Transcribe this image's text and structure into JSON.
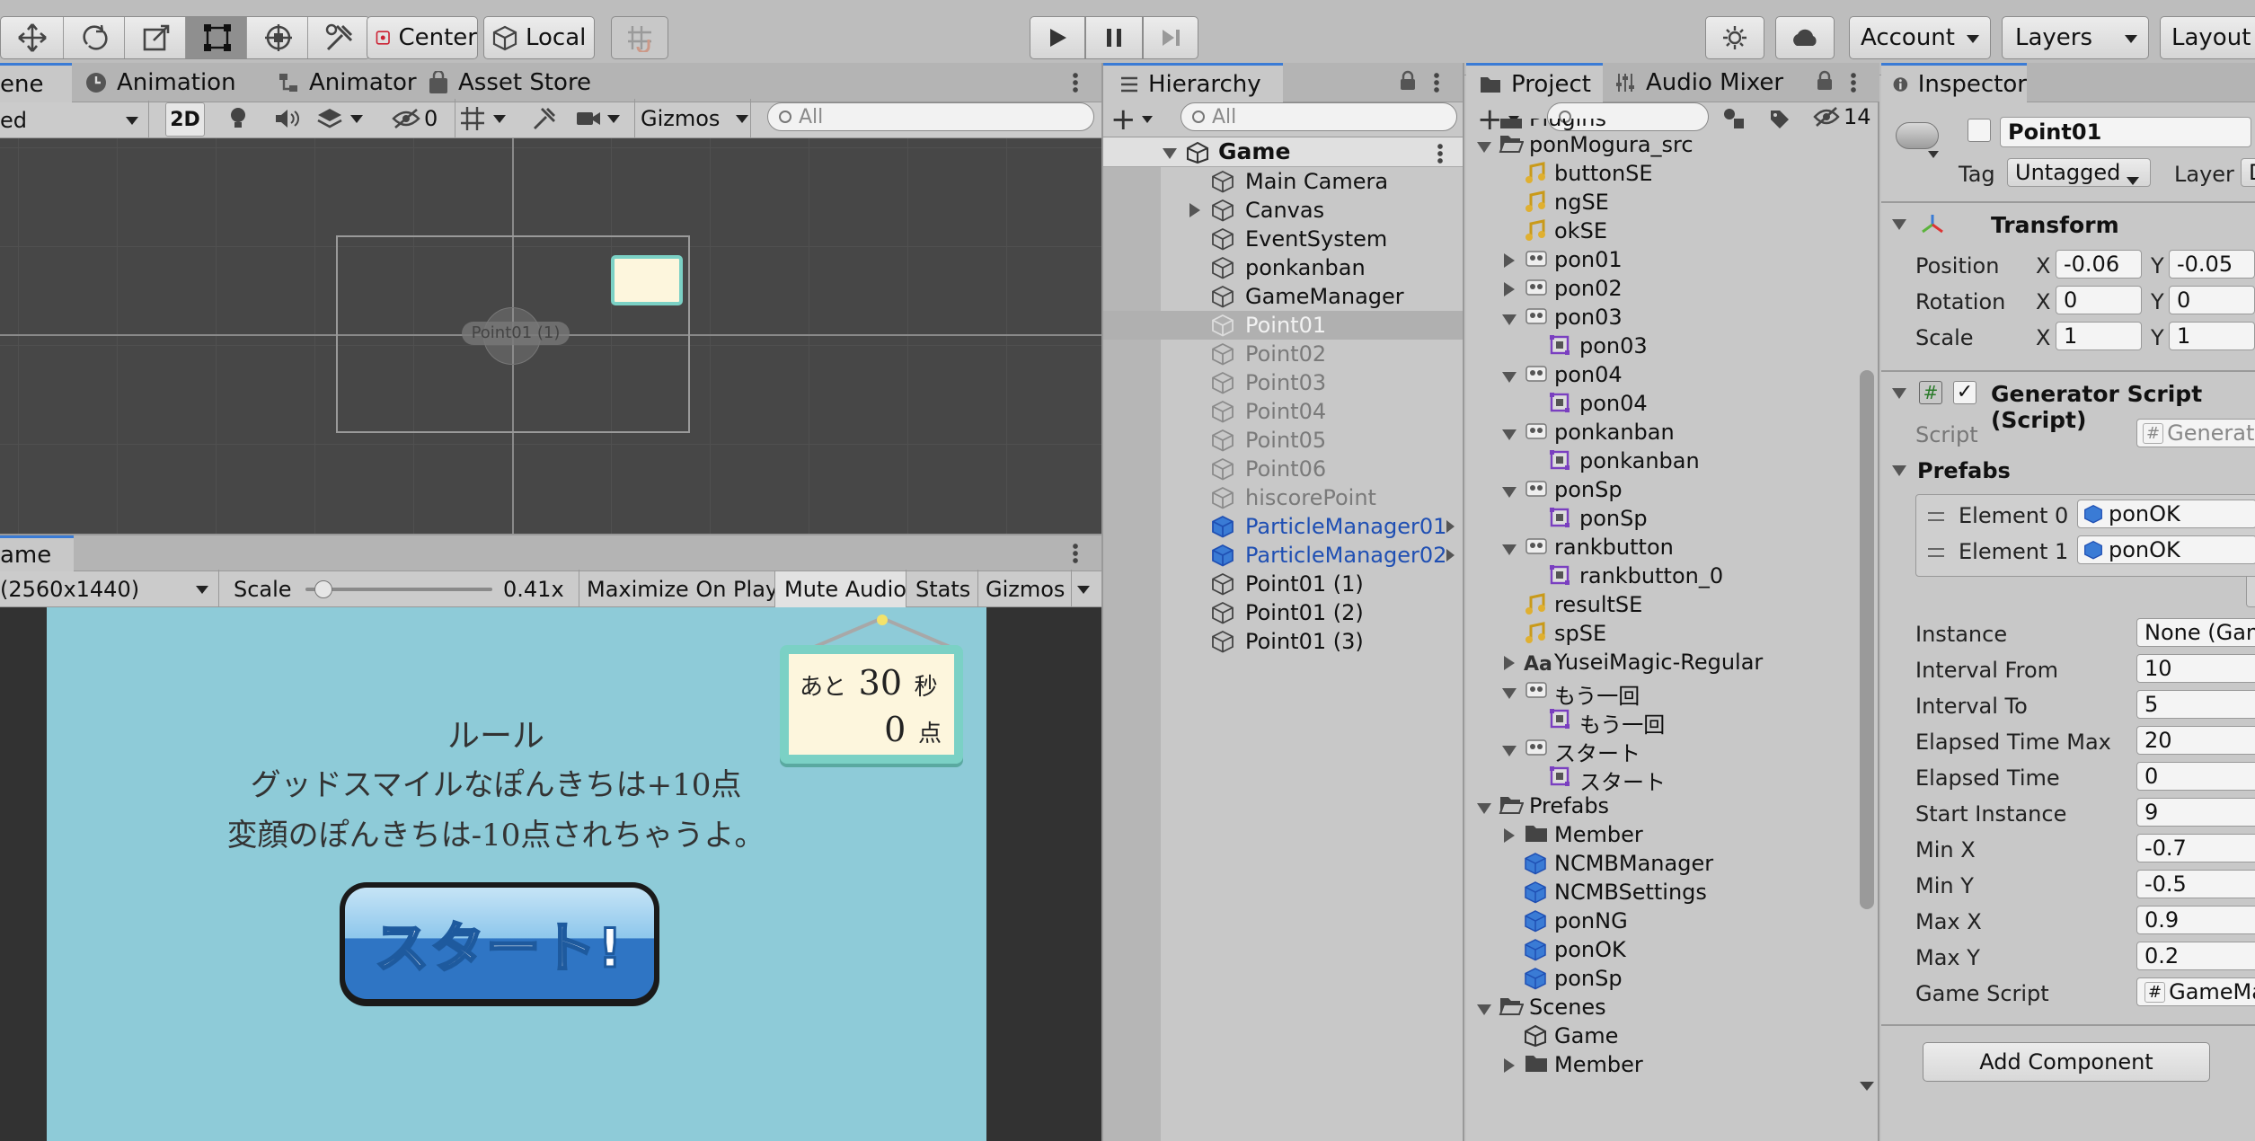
{
  "toolbar": {
    "center": "Center",
    "local": "Local",
    "account": "Account",
    "layers": "Layers",
    "layout": "Layout"
  },
  "scene": {
    "tabs": [
      "ene",
      "Animation",
      "Animator",
      "Asset Store"
    ],
    "shading": "ed",
    "mode2d": "2D",
    "hidden_count": "0",
    "gizmos": "Gizmos",
    "search_placeholder": "All",
    "object_label": "Point01 (1)"
  },
  "game": {
    "tab": "ame",
    "resolution": "(2560x1440)",
    "scale_label": "Scale",
    "scale_value": "0.41x",
    "scale_level": 0.05,
    "buttons": [
      "Maximize On Play",
      "Mute Audio",
      "Stats",
      "Gizmos"
    ],
    "rule_title": "ルール",
    "rule_line1": "グッドスマイルなぽんきちは+10点",
    "rule_line2": "変顔のぽんきちは-10点されちゃうよ。",
    "timer_prefix": "あと",
    "timer_value": "30",
    "timer_unit": "秒",
    "score_value": "0",
    "score_unit": "点",
    "start_button": "スタート!"
  },
  "hierarchy": {
    "tab": "Hierarchy",
    "search_placeholder": "All",
    "scene": "Game",
    "items": [
      {
        "label": "Main Camera",
        "state": "normal",
        "expandable": false
      },
      {
        "label": "Canvas",
        "state": "normal",
        "expandable": true
      },
      {
        "label": "EventSystem",
        "state": "normal",
        "expandable": false
      },
      {
        "label": "ponkanban",
        "state": "normal",
        "expandable": false
      },
      {
        "label": "GameManager",
        "state": "normal",
        "expandable": false
      },
      {
        "label": "Point01",
        "state": "selected",
        "expandable": false
      },
      {
        "label": "Point02",
        "state": "inactive",
        "expandable": false
      },
      {
        "label": "Point03",
        "state": "inactive",
        "expandable": false
      },
      {
        "label": "Point04",
        "state": "inactive",
        "expandable": false
      },
      {
        "label": "Point05",
        "state": "inactive",
        "expandable": false
      },
      {
        "label": "Point06",
        "state": "inactive",
        "expandable": false
      },
      {
        "label": "hiscorePoint",
        "state": "inactive",
        "expandable": false
      },
      {
        "label": "ParticleManager01",
        "state": "prefab",
        "expandable": false
      },
      {
        "label": "ParticleManager02",
        "state": "prefab",
        "expandable": false
      },
      {
        "label": "Point01 (1)",
        "state": "normal",
        "expandable": false
      },
      {
        "label": "Point01 (2)",
        "state": "normal",
        "expandable": false
      },
      {
        "label": "Point01 (3)",
        "state": "normal",
        "expandable": false
      }
    ]
  },
  "project": {
    "tabs": [
      "Project",
      "Audio Mixer"
    ],
    "hidden_count": "14",
    "items": [
      {
        "label": "Plugins",
        "indent": 0,
        "fold": "none",
        "icon": "folder"
      },
      {
        "label": "ponMogura_src",
        "indent": 0,
        "fold": "open",
        "icon": "folder-open"
      },
      {
        "label": "buttonSE",
        "indent": 1,
        "fold": "none",
        "icon": "audio"
      },
      {
        "label": "ngSE",
        "indent": 1,
        "fold": "none",
        "icon": "audio"
      },
      {
        "label": "okSE",
        "indent": 1,
        "fold": "none",
        "icon": "audio"
      },
      {
        "label": "pon01",
        "indent": 1,
        "fold": "closed",
        "icon": "texture"
      },
      {
        "label": "pon02",
        "indent": 1,
        "fold": "closed",
        "icon": "texture"
      },
      {
        "label": "pon03",
        "indent": 1,
        "fold": "open",
        "icon": "texture"
      },
      {
        "label": "pon03",
        "indent": 2,
        "fold": "none",
        "icon": "sprite"
      },
      {
        "label": "pon04",
        "indent": 1,
        "fold": "open",
        "icon": "texture"
      },
      {
        "label": "pon04",
        "indent": 2,
        "fold": "none",
        "icon": "sprite"
      },
      {
        "label": "ponkanban",
        "indent": 1,
        "fold": "open",
        "icon": "texture"
      },
      {
        "label": "ponkanban",
        "indent": 2,
        "fold": "none",
        "icon": "sprite"
      },
      {
        "label": "ponSp",
        "indent": 1,
        "fold": "open",
        "icon": "texture"
      },
      {
        "label": "ponSp",
        "indent": 2,
        "fold": "none",
        "icon": "sprite"
      },
      {
        "label": "rankbutton",
        "indent": 1,
        "fold": "open",
        "icon": "texture"
      },
      {
        "label": "rankbutton_0",
        "indent": 2,
        "fold": "none",
        "icon": "sprite"
      },
      {
        "label": "resultSE",
        "indent": 1,
        "fold": "none",
        "icon": "audio"
      },
      {
        "label": "spSE",
        "indent": 1,
        "fold": "none",
        "icon": "audio"
      },
      {
        "label": "YuseiMagic-Regular",
        "indent": 1,
        "fold": "closed",
        "icon": "font"
      },
      {
        "label": "もう一回",
        "indent": 1,
        "fold": "open",
        "icon": "texture"
      },
      {
        "label": "もう一回",
        "indent": 2,
        "fold": "none",
        "icon": "sprite"
      },
      {
        "label": "スタート",
        "indent": 1,
        "fold": "open",
        "icon": "texture"
      },
      {
        "label": "スタート",
        "indent": 2,
        "fold": "none",
        "icon": "sprite"
      },
      {
        "label": "Prefabs",
        "indent": 0,
        "fold": "open",
        "icon": "folder-open"
      },
      {
        "label": "Member",
        "indent": 1,
        "fold": "closed",
        "icon": "folder"
      },
      {
        "label": "NCMBManager",
        "indent": 1,
        "fold": "none",
        "icon": "prefab"
      },
      {
        "label": "NCMBSettings",
        "indent": 1,
        "fold": "none",
        "icon": "prefab"
      },
      {
        "label": "ponNG",
        "indent": 1,
        "fold": "none",
        "icon": "prefab"
      },
      {
        "label": "ponOK",
        "indent": 1,
        "fold": "none",
        "icon": "prefab"
      },
      {
        "label": "ponSp",
        "indent": 1,
        "fold": "none",
        "icon": "prefab"
      },
      {
        "label": "Scenes",
        "indent": 0,
        "fold": "open",
        "icon": "folder-open"
      },
      {
        "label": "Game",
        "indent": 1,
        "fold": "none",
        "icon": "unity"
      },
      {
        "label": "Member",
        "indent": 1,
        "fold": "closed",
        "icon": "folder"
      }
    ]
  },
  "inspector": {
    "tab": "Inspector",
    "name": "Point01",
    "tag_label": "Tag",
    "tag_value": "Untagged",
    "layer_label": "Layer",
    "layer_value": "D",
    "transform": {
      "title": "Transform",
      "rows": [
        {
          "label": "Position",
          "x": "-0.06",
          "y": "-0.05"
        },
        {
          "label": "Rotation",
          "x": "0",
          "y": "0"
        },
        {
          "label": "Scale",
          "x": "1",
          "y": "1"
        }
      ]
    },
    "script_component": {
      "title": "Generator Script (Script)",
      "script_label": "Script",
      "script_value": "Generator",
      "prefabs_label": "Prefabs",
      "elements": [
        {
          "label": "Element 0",
          "value": "ponOK"
        },
        {
          "label": "Element 1",
          "value": "ponOK"
        }
      ],
      "fields": [
        {
          "label": "Instance",
          "value": "None (Game"
        },
        {
          "label": "Interval From",
          "value": "10"
        },
        {
          "label": "Interval To",
          "value": "5"
        },
        {
          "label": "Elapsed Time Max",
          "value": "20"
        },
        {
          "label": "Elapsed Time",
          "value": "0"
        },
        {
          "label": "Start Instance",
          "value": "9"
        },
        {
          "label": "Min X",
          "value": "-0.7"
        },
        {
          "label": "Min Y",
          "value": "-0.5"
        },
        {
          "label": "Max X",
          "value": "0.9"
        },
        {
          "label": "Max Y",
          "value": "0.2"
        },
        {
          "label": "Game Script",
          "value": "GameMa"
        }
      ]
    },
    "add_component": "Add Component"
  },
  "colors": {
    "accent": "#3a7bd5",
    "game_bg": "#8ecbd8",
    "start_button": "#2f75c4",
    "selected_row": "#b0b0b0",
    "inactive_text": "#7a7a7a",
    "prefab_text": "#1f4fb3"
  }
}
